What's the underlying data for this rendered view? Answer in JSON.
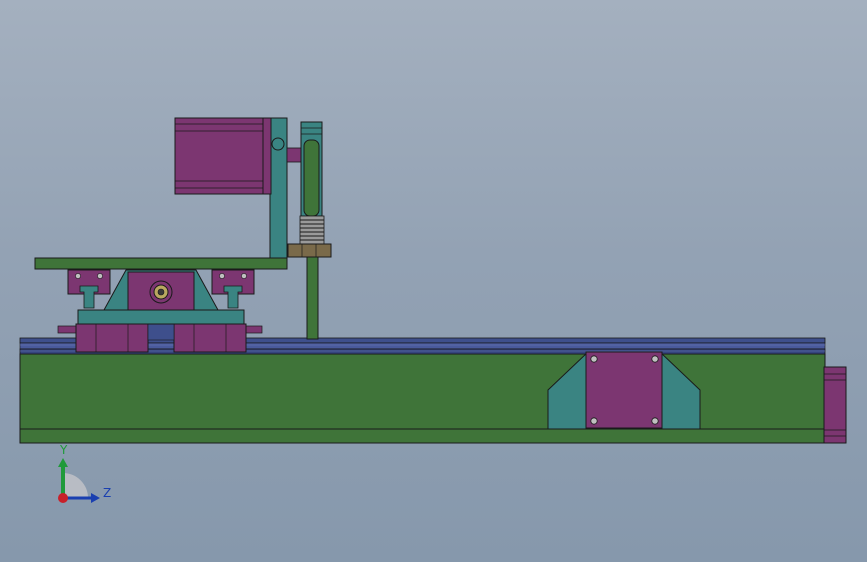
{
  "viewport": {
    "background_top": "#a4b0bf",
    "background_bottom": "#8698ac"
  },
  "colors": {
    "base_green": "#3f7439",
    "rail_blue": "#3e4f8c",
    "plate_teal": "#3a8482",
    "motor_purple": "#7c3671",
    "edge": "#1a1a1a",
    "bronze": "#7a6a4a"
  },
  "triad": {
    "y_label": "Y",
    "z_label": "Z",
    "y_color": "#1f9a3a",
    "z_color": "#1a3fb0",
    "origin_color": "#c8202a"
  }
}
